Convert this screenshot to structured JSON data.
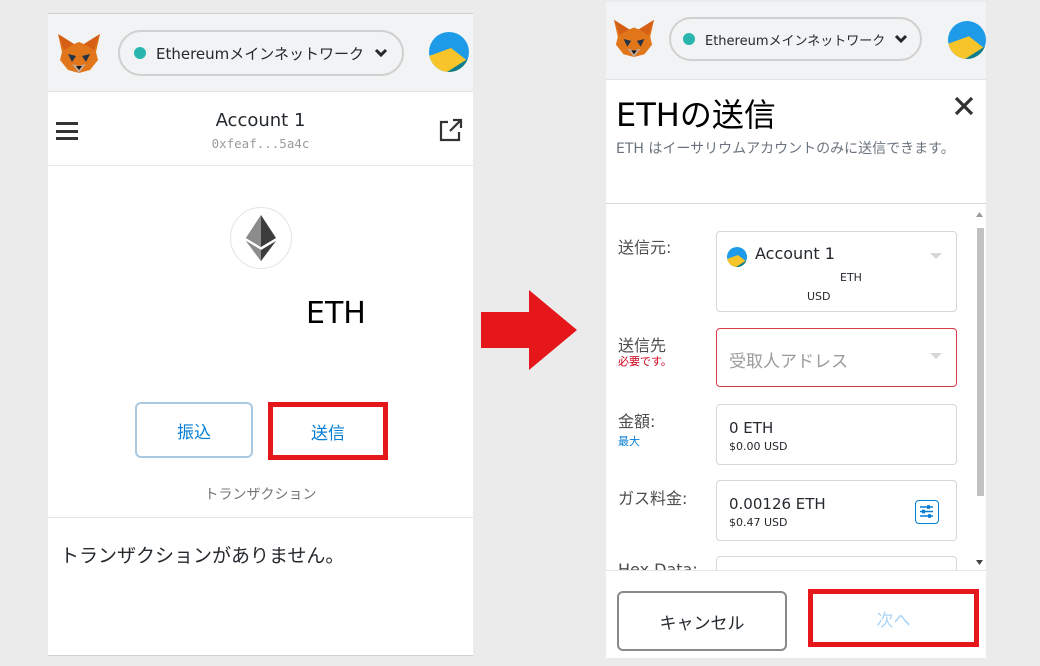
{
  "colors": {
    "accent_blue": "#037dd6",
    "highlight_red": "#e5171b",
    "network_dot": "#29b6af",
    "error_red": "#d0021b"
  },
  "left": {
    "network": {
      "name": "Ethereumメインネットワーク",
      "icon": "chevron-down-icon"
    },
    "account": {
      "name": "Account 1",
      "address": "0xfeaf...5a4c"
    },
    "balance": {
      "symbol": "ETH"
    },
    "buttons": {
      "receive": "振込",
      "send": "送信"
    },
    "transactions": {
      "tab": "トランザクション",
      "empty": "トランザクションがありません。"
    }
  },
  "right": {
    "network": {
      "name": "Ethereumメインネットワーク"
    },
    "title": "ETHの送信",
    "subtitle": "ETH はイーサリウムアカウントのみに送信できます。",
    "from": {
      "label": "送信元:",
      "account": "Account 1",
      "eth": "ETH",
      "usd": "USD"
    },
    "to": {
      "label": "送信先",
      "required": "必要です。",
      "placeholder": "受取人アドレス"
    },
    "amount": {
      "label": "金額:",
      "max": "最大",
      "value": "0  ETH",
      "usd": "$0.00 USD"
    },
    "gas": {
      "label": "ガス料金:",
      "value": "0.00126  ETH",
      "usd": "$0.47 USD"
    },
    "hex": {
      "label": "Hex Data:"
    },
    "buttons": {
      "cancel": "キャンセル",
      "next": "次へ"
    }
  }
}
